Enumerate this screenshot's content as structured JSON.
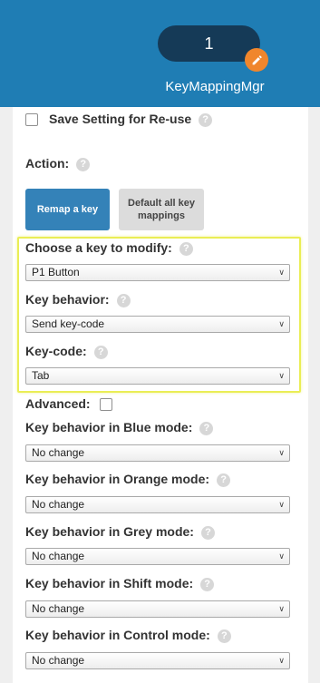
{
  "header": {
    "count": "1",
    "title": "KeyMappingMgr"
  },
  "save_setting": {
    "label": "Save Setting for Re-use",
    "help": "?"
  },
  "action": {
    "label": "Action:",
    "help": "?",
    "remap_label": "Remap a key",
    "default_label_line1": "Default all key",
    "default_label_line2": "mappings"
  },
  "modify": {
    "label": "Choose a key to modify:",
    "help": "?",
    "value": "P1 Button"
  },
  "behavior": {
    "label": "Key behavior:",
    "help": "?",
    "value": "Send key-code"
  },
  "keycode": {
    "label": "Key-code:",
    "help": "?",
    "value": "Tab"
  },
  "advanced": {
    "label": "Advanced:"
  },
  "modes": [
    {
      "label": "Key behavior in Blue mode:",
      "help": "?",
      "value": "No change"
    },
    {
      "label": "Key behavior in Orange mode:",
      "help": "?",
      "value": "No change"
    },
    {
      "label": "Key behavior in Grey mode:",
      "help": "?",
      "value": "No change"
    },
    {
      "label": "Key behavior in Shift mode:",
      "help": "?",
      "value": "No change"
    },
    {
      "label": "Key behavior in Control mode:",
      "help": "?",
      "value": "No change"
    }
  ],
  "colors": {
    "header": "#1f7db4",
    "pill": "#153a57",
    "edit_button": "#f0862c",
    "primary_button": "#3482b8",
    "highlight_border": "#eaee55"
  },
  "icons": {
    "edit": "pencil-icon",
    "help": "question-icon",
    "dropdown": "chevron-down-icon"
  }
}
